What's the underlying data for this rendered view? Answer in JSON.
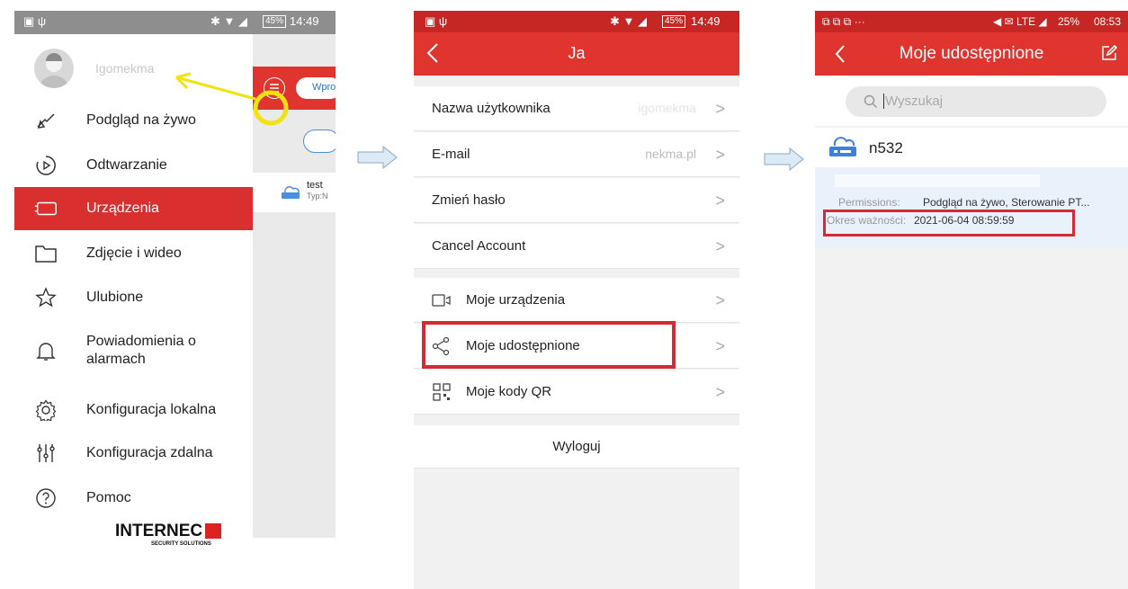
{
  "screen1": {
    "status": {
      "left_icons": "▣ ψ",
      "right_icons": "✱ ▼ ◢",
      "battery": "45%",
      "time": "14:49"
    },
    "username": "Igomekma",
    "menu": [
      {
        "label": "Podgląd na żywo",
        "icon": "eye-icon"
      },
      {
        "label": "Odtwarzanie",
        "icon": "playback-icon"
      },
      {
        "label": "Urządzenia",
        "icon": "device-icon"
      },
      {
        "label": "Zdjęcie i wideo",
        "icon": "folder-icon"
      },
      {
        "label": "Ulubione",
        "icon": "star-icon"
      },
      {
        "label": "Powiadomienia o alarmach",
        "icon": "bell-icon"
      },
      {
        "label": "Konfiguracja lokalna",
        "icon": "gear-icon"
      },
      {
        "label": "Konfiguracja zdalna",
        "icon": "sliders-icon"
      },
      {
        "label": "Pomoc",
        "icon": "help-icon"
      }
    ],
    "logo_main": "INTERNEC",
    "logo_sub": "SECURITY SOLUTIONS",
    "behind": {
      "pill_text": "Wpro",
      "device_name": "test",
      "device_type": "Typ:N"
    }
  },
  "screen2": {
    "status": {
      "left_icons": "▣ ψ",
      "right_icons": "✱ ▼ ◢",
      "battery": "45%",
      "time": "14:49"
    },
    "title": "Ja",
    "rows_group1": [
      {
        "label": "Nazwa użytkownika",
        "value": "igomekma"
      },
      {
        "label": "E-mail",
        "value": "nekma.pl"
      },
      {
        "label": "Zmień hasło",
        "value": ""
      },
      {
        "label": "Cancel Account",
        "value": ""
      }
    ],
    "rows_group2": [
      {
        "label": "Moje urządzenia",
        "icon": "camera-icon"
      },
      {
        "label": "Moje udostępnione",
        "icon": "share-icon"
      },
      {
        "label": "Moje kody QR",
        "icon": "qr-icon"
      }
    ],
    "logout": "Wyloguj",
    "chevron": ">"
  },
  "screen3": {
    "status": {
      "left_icons": "⧉ ⧉ ⧉ ···",
      "right_icons": "◀ ✉ LTE ◢",
      "battery": "25%",
      "time": "08:53"
    },
    "title": "Moje udostępnione",
    "search_placeholder": "Wyszukaj",
    "device_name": "n532",
    "permissions_label": "Permissions:",
    "permissions_value": "Podgląd na żywo,  Sterowanie PT...",
    "validity_label": "Okres ważności:",
    "validity_value": "2021-06-04 08:59:59"
  },
  "colors": {
    "brand_red": "#e0342f",
    "highlight_red": "#d9302f",
    "annotation_yellow": "#f2e20d",
    "annotation_red": "#d42a35"
  }
}
